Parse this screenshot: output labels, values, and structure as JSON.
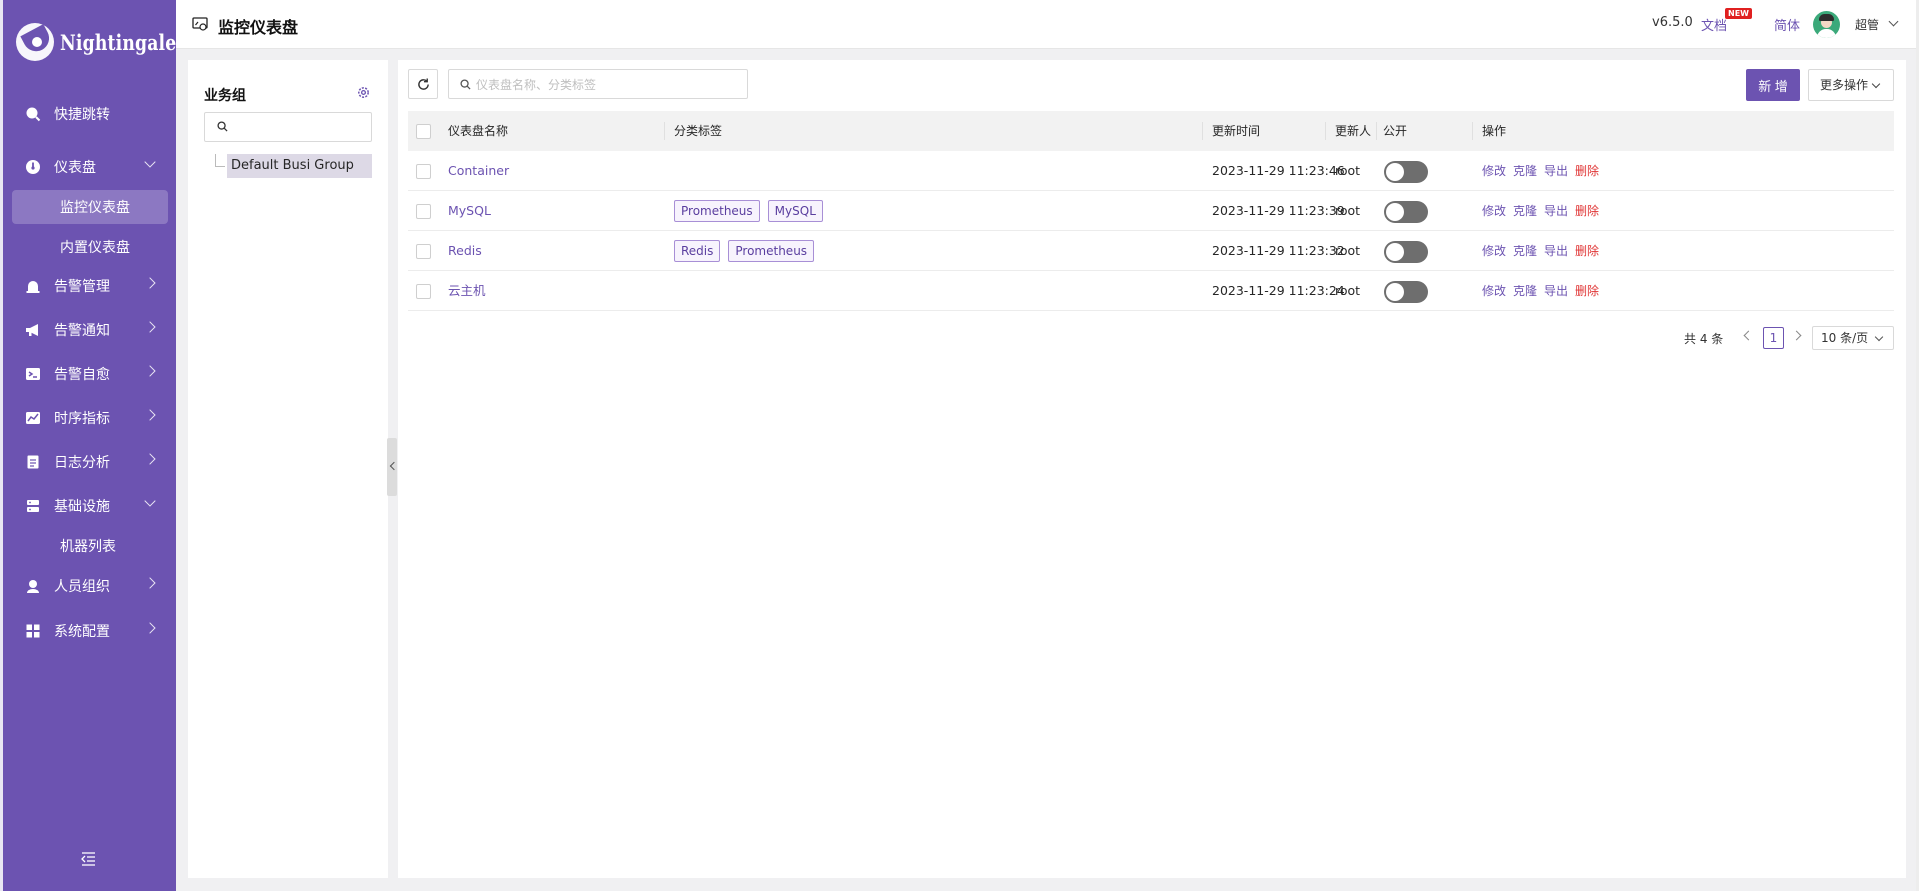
{
  "brand": {
    "name": "Nightingale",
    "color": "#6c53b1"
  },
  "sidebar": {
    "items": [
      {
        "label": "快捷跳转",
        "icon": "search-icon"
      },
      {
        "label": "仪表盘",
        "icon": "dashboard-icon",
        "expanded": true,
        "children": [
          {
            "label": "监控仪表盘",
            "active": true
          },
          {
            "label": "内置仪表盘"
          }
        ]
      },
      {
        "label": "告警管理",
        "icon": "alert-bell-icon"
      },
      {
        "label": "告警通知",
        "icon": "megaphone-icon"
      },
      {
        "label": "告警自愈",
        "icon": "terminal-icon"
      },
      {
        "label": "时序指标",
        "icon": "line-chart-icon"
      },
      {
        "label": "日志分析",
        "icon": "log-file-icon"
      },
      {
        "label": "基础设施",
        "icon": "server-icon",
        "expanded": true,
        "children": [
          {
            "label": "机器列表"
          }
        ]
      },
      {
        "label": "人员组织",
        "icon": "user-icon"
      },
      {
        "label": "系统配置",
        "icon": "settings-grid-icon"
      }
    ]
  },
  "header": {
    "title": "监控仪表盘",
    "version": "v6.5.0",
    "docs": "文档",
    "new_badge": "NEW",
    "lang": "简体",
    "user": "超管"
  },
  "group_panel": {
    "title": "业务组",
    "search_placeholder": "",
    "tree": [
      {
        "label": "Default Busi Group",
        "selected": true
      }
    ]
  },
  "toolbar": {
    "search_placeholder": "仪表盘名称、分类标签",
    "add_label": "新 增",
    "more_label": "更多操作"
  },
  "table": {
    "columns": [
      "仪表盘名称",
      "分类标签",
      "更新时间",
      "更新人",
      "公开",
      "操作"
    ],
    "rows": [
      {
        "name": "Container",
        "tags": [],
        "updated": "2023-11-29 11:23:46",
        "updater": "root",
        "public": false
      },
      {
        "name": "MySQL",
        "tags": [
          "Prometheus",
          "MySQL"
        ],
        "updated": "2023-11-29 11:23:39",
        "updater": "root",
        "public": false
      },
      {
        "name": "Redis",
        "tags": [
          "Redis",
          "Prometheus"
        ],
        "updated": "2023-11-29 11:23:32",
        "updater": "root",
        "public": false
      },
      {
        "name": "云主机",
        "tags": [],
        "updated": "2023-11-29 11:23:24",
        "updater": "root",
        "public": false
      }
    ],
    "actions": {
      "edit": "修改",
      "clone": "克隆",
      "export": "导出",
      "delete": "删除"
    }
  },
  "pagination": {
    "total": "共 4 条",
    "current": "1",
    "page_size": "10 条/页"
  }
}
